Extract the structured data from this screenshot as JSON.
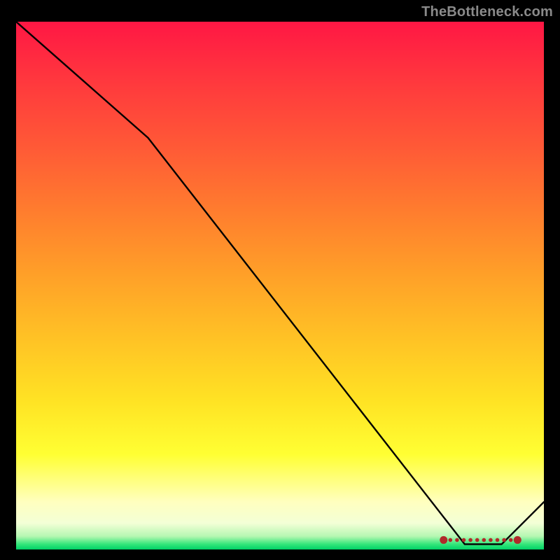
{
  "attribution": "TheBottleneck.com",
  "chart_data": {
    "type": "line",
    "title": "",
    "xlabel": "",
    "ylabel": "",
    "xlim": [
      0,
      100
    ],
    "ylim": [
      0,
      100
    ],
    "series": [
      {
        "name": "curve",
        "x": [
          0,
          25,
          85,
          92,
          100
        ],
        "values": [
          100,
          78,
          1,
          1,
          9
        ]
      }
    ],
    "markers": {
      "name": "band",
      "x_start": 81,
      "x_end": 95,
      "y": 1.8,
      "count": 12
    },
    "background_gradient_note": "vertical red→orange→yellow→pale→green"
  }
}
